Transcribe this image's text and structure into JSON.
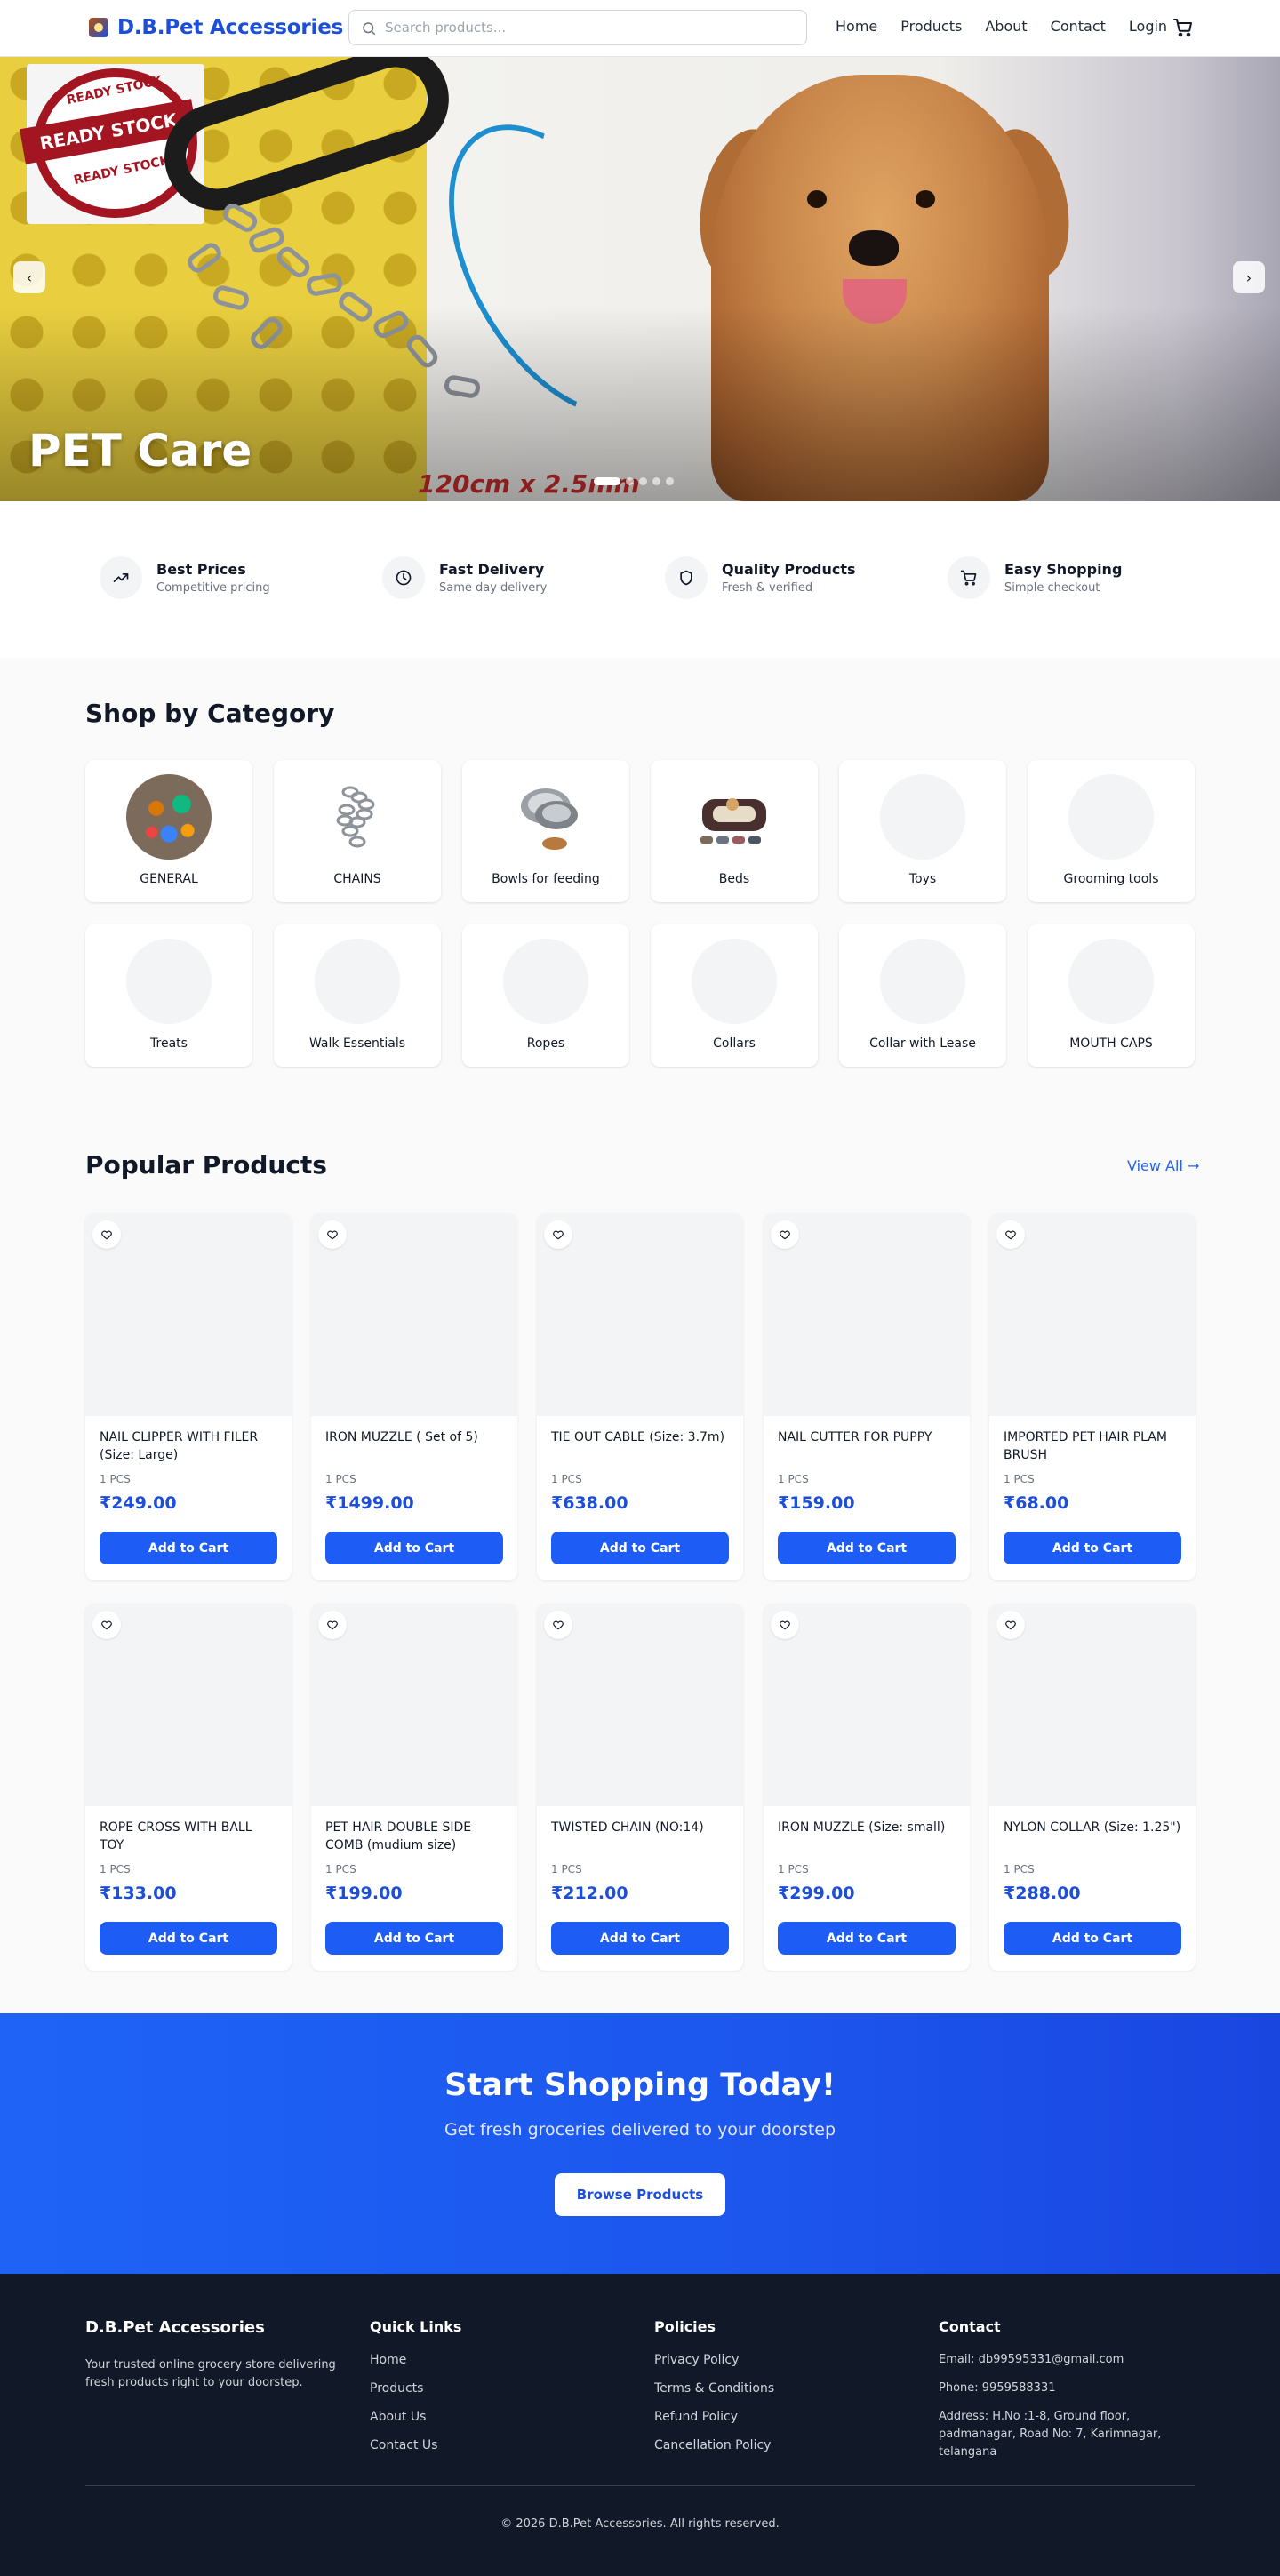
{
  "header": {
    "brand": "D.B.Pet Accessories",
    "search_placeholder": "Search products...",
    "nav": [
      "Home",
      "Products",
      "About",
      "Contact",
      "Login"
    ]
  },
  "hero": {
    "title": "PET Care",
    "caption": "120cm x 2.5mm",
    "stamp": {
      "top": "READY STOCK",
      "band": "READY STOCK",
      "bottom": "READY STOCK"
    },
    "slides": 5,
    "active_slide": 1
  },
  "features": [
    {
      "title": "Best Prices",
      "sub": "Competitive pricing",
      "icon": "trending-up-icon"
    },
    {
      "title": "Fast Delivery",
      "sub": "Same day delivery",
      "icon": "clock-icon"
    },
    {
      "title": "Quality Products",
      "sub": "Fresh & verified",
      "icon": "shield-icon"
    },
    {
      "title": "Easy Shopping",
      "sub": "Simple checkout",
      "icon": "cart-icon"
    }
  ],
  "categories": {
    "title": "Shop by Category",
    "items": [
      "GENERAL",
      "CHAINS",
      "Bowls for feeding",
      "Beds",
      "Toys",
      "Grooming tools",
      "Treats",
      "Walk Essentials",
      "Ropes",
      "Collars",
      "Collar with Lease",
      "MOUTH CAPS"
    ]
  },
  "products": {
    "title": "Popular Products",
    "view_all": "View All →",
    "add_label": "Add to Cart",
    "items": [
      {
        "name": "NAIL CLIPPER WITH FILER (Size: Large)",
        "unit": "1 PCS",
        "price": "₹249.00"
      },
      {
        "name": "IRON MUZZLE ( Set of 5)",
        "unit": "1 PCS",
        "price": "₹1499.00"
      },
      {
        "name": "TIE OUT CABLE (Size: 3.7m)",
        "unit": "1 PCS",
        "price": "₹638.00"
      },
      {
        "name": "NAIL CUTTER FOR PUPPY",
        "unit": "1 PCS",
        "price": "₹159.00"
      },
      {
        "name": "IMPORTED PET HAIR PLAM BRUSH",
        "unit": "1 PCS",
        "price": "₹68.00"
      },
      {
        "name": "ROPE CROSS WITH BALL TOY",
        "unit": "1 PCS",
        "price": "₹133.00"
      },
      {
        "name": "PET HAIR DOUBLE SIDE COMB (mudium size)",
        "unit": "1 PCS",
        "price": "₹199.00"
      },
      {
        "name": "TWISTED CHAIN (NO:14)",
        "unit": "1 PCS",
        "price": "₹212.00"
      },
      {
        "name": "IRON MUZZLE (Size: small)",
        "unit": "1 PCS",
        "price": "₹299.00"
      },
      {
        "name": "NYLON COLLAR (Size: 1.25\")",
        "unit": "1 PCS",
        "price": "₹288.00"
      }
    ]
  },
  "cta": {
    "title": "Start Shopping Today!",
    "sub": "Get fresh groceries delivered to your doorstep",
    "button": "Browse Products"
  },
  "footer": {
    "brand": "D.B.Pet Accessories",
    "desc": "Your trusted online grocery store delivering fresh products right to your doorstep.",
    "quick_links_title": "Quick Links",
    "quick_links": [
      "Home",
      "Products",
      "About Us",
      "Contact Us"
    ],
    "policies_title": "Policies",
    "policies": [
      "Privacy Policy",
      "Terms & Conditions",
      "Refund Policy",
      "Cancellation Policy"
    ],
    "contact_title": "Contact",
    "email": "Email: db99595331@gmail.com",
    "phone": "Phone: 9959588331",
    "address": "Address: H.No :1-8, Ground floor, padmanagar, Road No: 7, Karimnagar, telangana",
    "copyright": "© 2026 D.B.Pet Accessories. All rights reserved."
  },
  "colors": {
    "brand": "#1d4ed8",
    "button": "#1d5cf5",
    "footer_bg": "#111827"
  }
}
